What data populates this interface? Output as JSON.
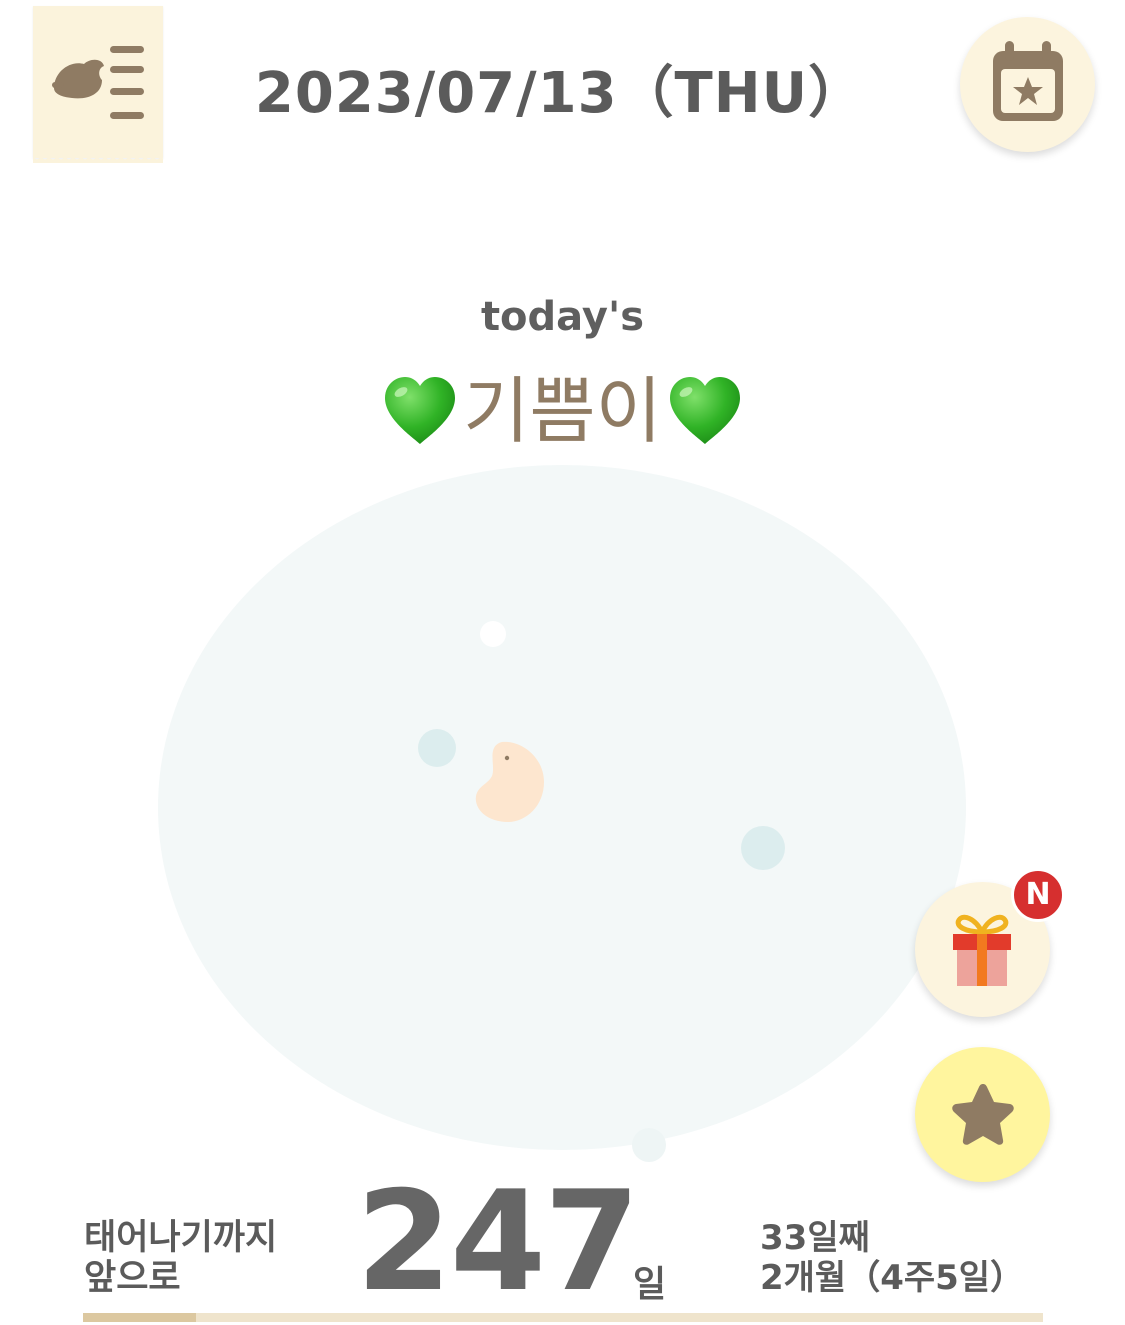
{
  "header": {
    "date": "2023/07/13（THU）",
    "menu_icon": "diary-list-icon",
    "calendar_icon": "calendar-star-icon"
  },
  "today": {
    "label": "today's",
    "nickname": "기쁨이",
    "heart_icon": "green-heart-icon"
  },
  "floating": {
    "gift_icon": "gift-icon",
    "new_badge": "N",
    "star_icon": "star-icon"
  },
  "countdown": {
    "label_line1": "태어나기까지",
    "label_line2": "앞으로",
    "days": "247",
    "unit": "일",
    "day_count": "33일째",
    "week_info": "2개월（4주5일）",
    "progress_fraction": 0.118
  },
  "colors": {
    "brown": "#8f7b63",
    "cream": "#fcf4de",
    "yellow": "#fff59e",
    "badge_red": "#d62f2f",
    "green_heart": "#33b52b"
  }
}
